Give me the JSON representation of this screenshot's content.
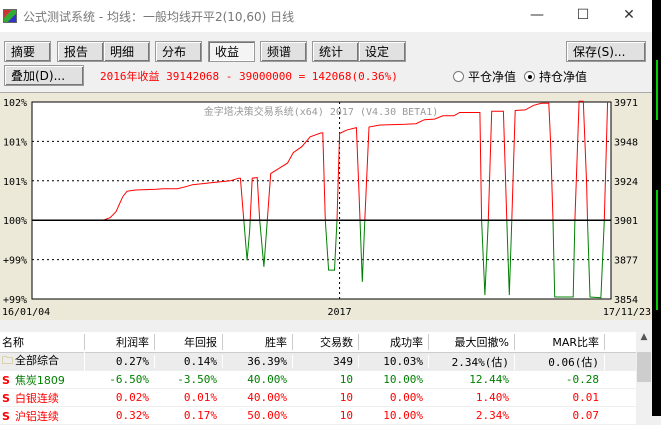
{
  "window": {
    "title": "公式测试系统 - 均线：一般均线开平2(10,60) 日线",
    "minimize": "—",
    "maximize": "☐",
    "close": "✕"
  },
  "toolbar": {
    "tabs": [
      "摘要",
      "报告",
      "明细",
      "分布",
      "收益",
      "频谱",
      "统计",
      "设定"
    ],
    "active": "收益",
    "save": "保存(S)...",
    "overlay": "叠加(D)..."
  },
  "summary": "2016年收益 39142068 - 39000000 = 142068(0.36%)",
  "radios": {
    "close_equity": "平仓净值",
    "hold_equity": "持仓净值",
    "selected": "持仓净值"
  },
  "chart_data": {
    "type": "line",
    "watermark": "金字塔决策交易系统(x64) 2017 (V4.30 BETA1)",
    "x_labels": [
      "16/01/04",
      "2017",
      "17/11/23"
    ],
    "x_range": [
      0,
      689
    ],
    "x_mid_day": 366,
    "y_range": [
      98.8,
      101.8
    ],
    "y_ticks": [
      101.8,
      101.2,
      100.6,
      100,
      99.4,
      98.8
    ],
    "y_labels_left": [
      "102%",
      "101%",
      "101%",
      "100%",
      "+99%",
      "+99%"
    ],
    "y_labels_right": [
      "3971",
      "3948",
      "3924",
      "3901",
      "3877",
      "3854"
    ],
    "baseline": 100,
    "colors": {
      "above": "#ff0000",
      "below": "#008000"
    },
    "points": [
      [
        0,
        100
      ],
      [
        85,
        100
      ],
      [
        93,
        100.04
      ],
      [
        100,
        100.13
      ],
      [
        108,
        100.36
      ],
      [
        113,
        100.44
      ],
      [
        123,
        100.46
      ],
      [
        148,
        100.47
      ],
      [
        156,
        100.48
      ],
      [
        173,
        100.48
      ],
      [
        183,
        100.51
      ],
      [
        191,
        100.54
      ],
      [
        213,
        100.57
      ],
      [
        236,
        100.6
      ],
      [
        246,
        100.64
      ],
      [
        248,
        100.64
      ],
      [
        252,
        100
      ],
      [
        256,
        99.39
      ],
      [
        259,
        99.85
      ],
      [
        262,
        100.64
      ],
      [
        268,
        100.65
      ],
      [
        271,
        100
      ],
      [
        276,
        99.29
      ],
      [
        280,
        100
      ],
      [
        284,
        100.71
      ],
      [
        294,
        100.79
      ],
      [
        304,
        100.87
      ],
      [
        311,
        101.03
      ],
      [
        321,
        101.12
      ],
      [
        331,
        101.27
      ],
      [
        344,
        101.33
      ],
      [
        346,
        101.33
      ],
      [
        349,
        100
      ],
      [
        353,
        99.24
      ],
      [
        360,
        99.24
      ],
      [
        363,
        100
      ],
      [
        366,
        101.32
      ],
      [
        374,
        101.37
      ],
      [
        386,
        101.41
      ],
      [
        389,
        100.46
      ],
      [
        393,
        99.06
      ],
      [
        396,
        100
      ],
      [
        401,
        101.42
      ],
      [
        414,
        101.45
      ],
      [
        444,
        101.46
      ],
      [
        457,
        101.47
      ],
      [
        467,
        101.53
      ],
      [
        479,
        101.54
      ],
      [
        489,
        101.59
      ],
      [
        502,
        101.59
      ],
      [
        509,
        101.64
      ],
      [
        533,
        101.64
      ],
      [
        535,
        100
      ],
      [
        539,
        98.86
      ],
      [
        543,
        100
      ],
      [
        547,
        101.66
      ],
      [
        561,
        101.66
      ],
      [
        565,
        100
      ],
      [
        568,
        98.86
      ],
      [
        571,
        100
      ],
      [
        575,
        101.67
      ],
      [
        587,
        101.68
      ],
      [
        597,
        101.75
      ],
      [
        606,
        101.78
      ],
      [
        615,
        101.78
      ],
      [
        617,
        101.22
      ],
      [
        620,
        100
      ],
      [
        622,
        98.83
      ],
      [
        644,
        98.83
      ],
      [
        646,
        100
      ],
      [
        651,
        101.81
      ],
      [
        656,
        101.81
      ],
      [
        660,
        100.56
      ],
      [
        661,
        100
      ],
      [
        664,
        98.83
      ],
      [
        677,
        98.82
      ],
      [
        681,
        100
      ],
      [
        685,
        101.81
      ]
    ]
  },
  "table": {
    "headers": [
      "名称",
      "利润率",
      "年回报",
      "胜率",
      "交易数",
      "成功率",
      "最大回撤%",
      "MAR比率"
    ],
    "rows": [
      {
        "cells": [
          "全部综合",
          "0.27%",
          "0.14%",
          "36.39%",
          "349",
          "10.03%",
          "2.34%(估)",
          "0.06(估)"
        ],
        "color": "#000000",
        "icon": "folder-icon"
      },
      {
        "cells": [
          "焦炭1809",
          "-6.50%",
          "-3.50%",
          "40.00%",
          "10",
          "10.00%",
          "12.44%",
          "-0.28"
        ],
        "color": "#008000",
        "icon": "S"
      },
      {
        "cells": [
          "白银连续",
          "0.02%",
          "0.01%",
          "40.00%",
          "10",
          "0.00%",
          "1.40%",
          "0.01"
        ],
        "color": "#ff0000",
        "icon": "S"
      },
      {
        "cells": [
          "沪铝连续",
          "0.32%",
          "0.17%",
          "50.00%",
          "10",
          "10.00%",
          "2.34%",
          "0.07"
        ],
        "color": "#ff0000",
        "icon": "S"
      }
    ]
  }
}
